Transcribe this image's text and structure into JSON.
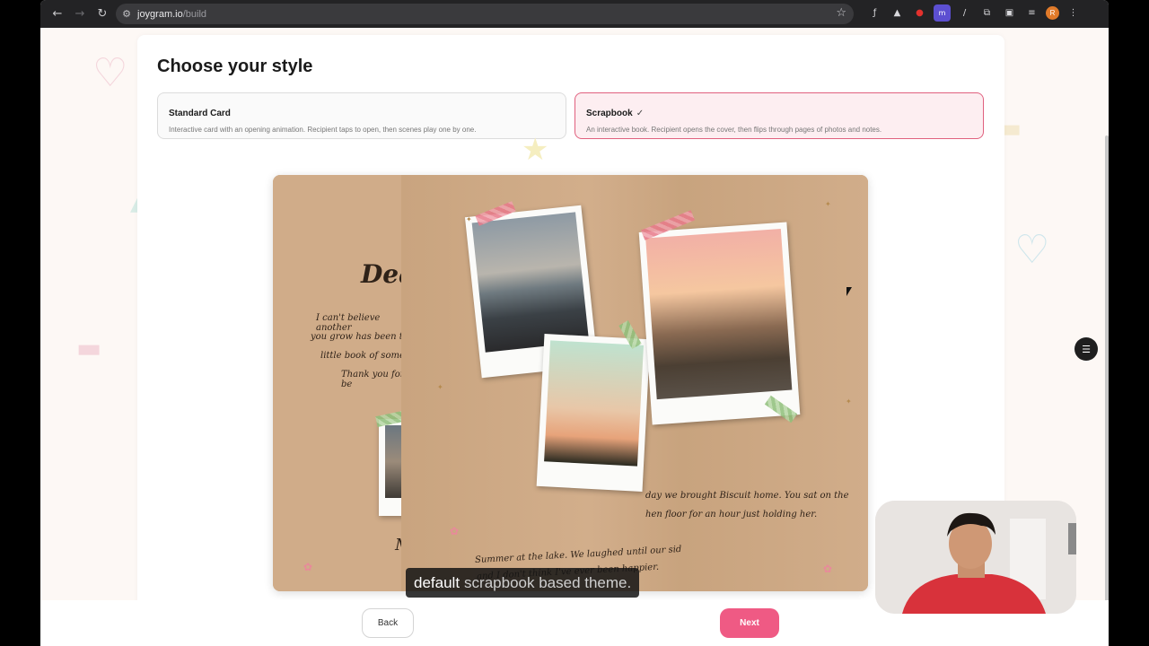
{
  "browser": {
    "url_host": "joygram.io",
    "url_path": "/build",
    "avatar_letter": "R",
    "extensions": [
      "ƒ",
      "▲",
      "●",
      "m",
      "/"
    ]
  },
  "page": {
    "title": "Choose your style",
    "options": [
      {
        "name": "Standard Card",
        "description": "Interactive card with an opening animation. Recipient taps to open, then scenes play one by one.",
        "selected": false
      },
      {
        "name": "Scrapbook",
        "description": "An interactive book. Recipient opens the cover, then flips through pages of photos and notes.",
        "selected": true
      }
    ]
  },
  "scrapbook": {
    "left_heading": "Dear",
    "left_lines": [
      "I can't believe another",
      "you grow has been the",
      "little book of some of",
      "Thank you for be"
    ],
    "left_bottom_1": "I",
    "left_bottom_2": "Me",
    "right_caption_1_line1": "day we brought Biscuit home. You sat on the",
    "right_caption_1_line2": "hen floor for an hour just holding her.",
    "right_caption_2_line1": "Summer at the lake. We laughed until our sid",
    "right_caption_2_line2": "and I don't think I've ever been happier."
  },
  "footer": {
    "back_label": "Back",
    "next_label": "Next"
  },
  "caption": {
    "word": "default",
    "rest": "scrapbook based theme."
  },
  "colors": {
    "accent": "#ef5a84",
    "selected_border": "#e0607e",
    "paper": "#cda985"
  }
}
